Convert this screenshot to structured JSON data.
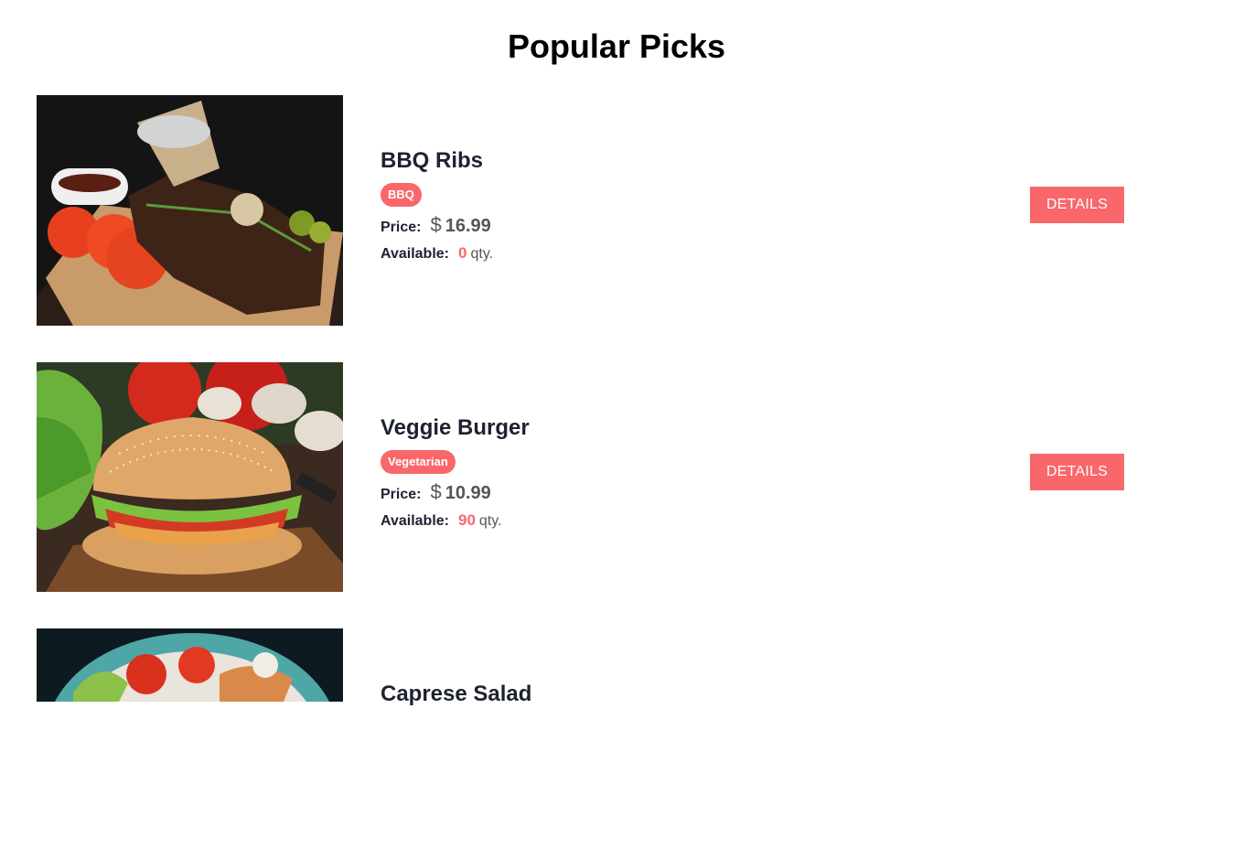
{
  "page": {
    "title": "Popular Picks"
  },
  "labels": {
    "price": "Price:",
    "available": "Available:",
    "currency": "$",
    "qty_unit": "qty.",
    "details": "DETAILS"
  },
  "products": [
    {
      "name": "BBQ Ribs",
      "category": "BBQ",
      "price": "16.99",
      "available": "0",
      "image_icon": "bbq-ribs-photo"
    },
    {
      "name": "Veggie Burger",
      "category": "Vegetarian",
      "price": "10.99",
      "available": "90",
      "image_icon": "veggie-burger-photo"
    },
    {
      "name": "Caprese Salad",
      "image_icon": "caprese-salad-photo"
    }
  ],
  "colors": {
    "accent": "#f9676b",
    "text_dark": "#1e2230",
    "text_muted": "#555555"
  }
}
